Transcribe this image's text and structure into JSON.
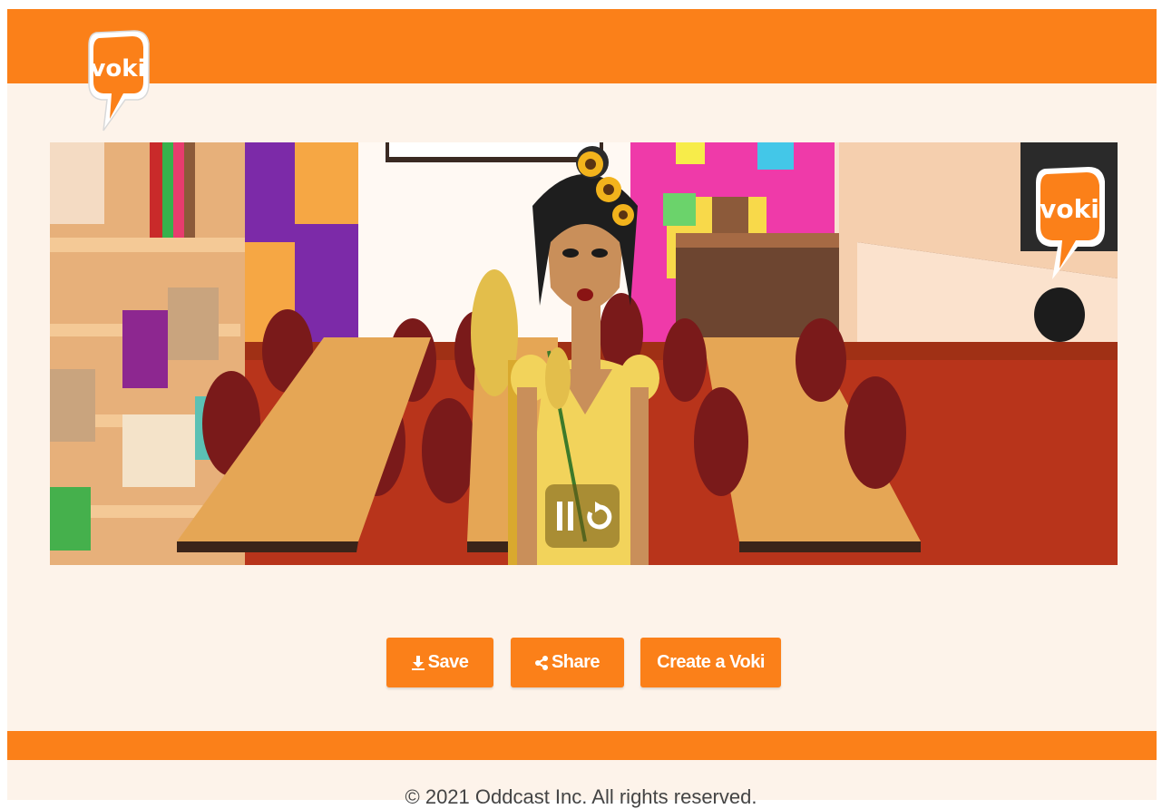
{
  "brand": {
    "logo_text": "voki",
    "primary_color": "#fb8019",
    "background_color": "#fdf3ea"
  },
  "stage": {
    "scene": "classroom",
    "character": "woman-with-sunflowers-and-wheat",
    "watermark_text": "voki"
  },
  "player": {
    "pause_icon": "pause-icon",
    "replay_icon": "replay-icon"
  },
  "actions": {
    "save_label": "Save",
    "share_label": "Share",
    "create_label": "Create a Voki"
  },
  "footer": {
    "copyright": "© 2021 Oddcast Inc. All rights reserved."
  }
}
